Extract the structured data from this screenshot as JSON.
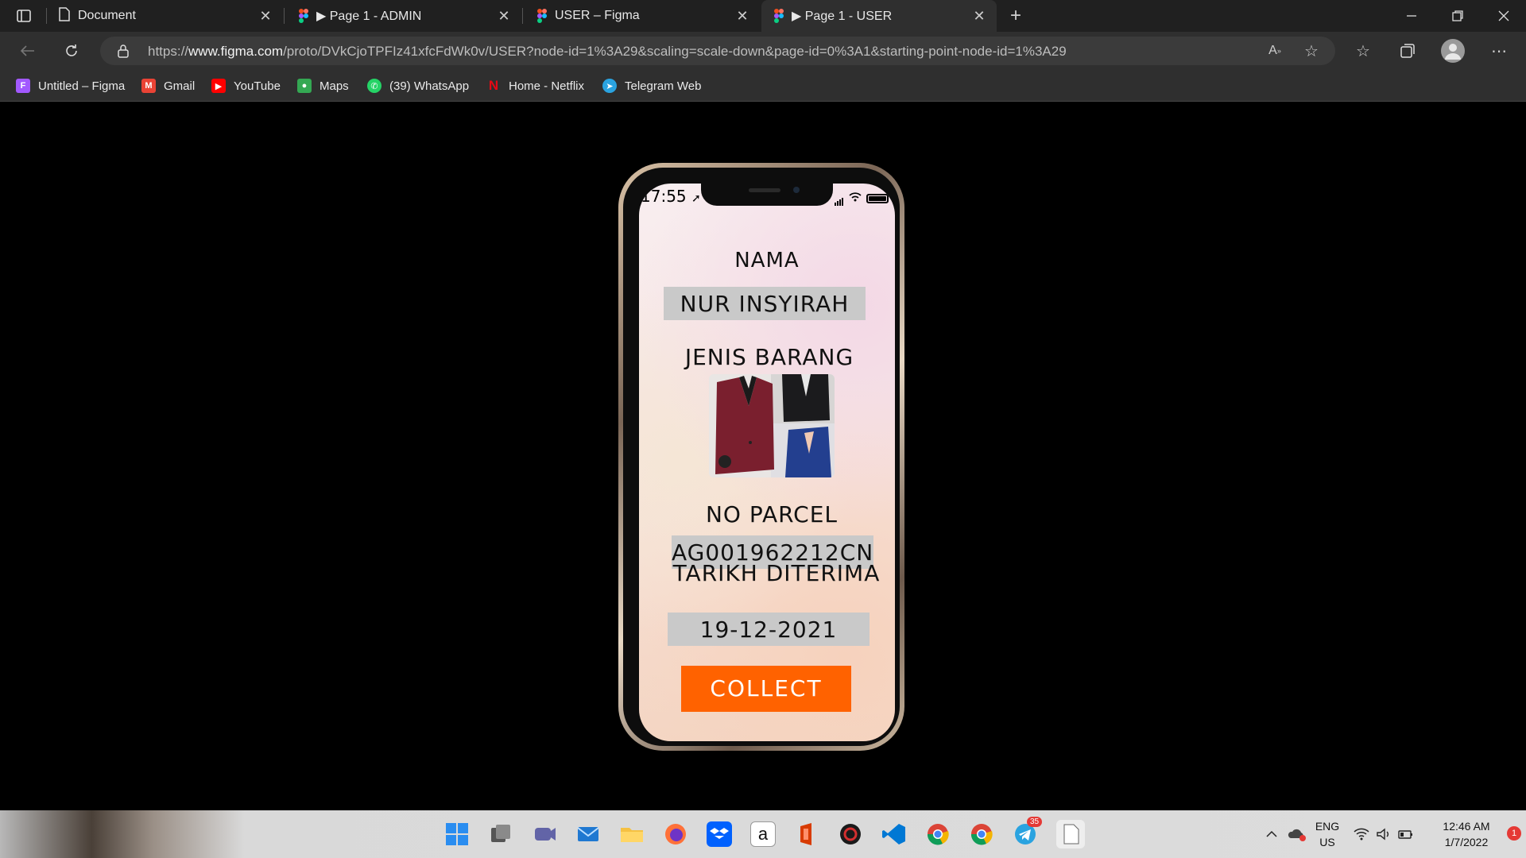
{
  "browser": {
    "tabs": [
      {
        "title": "Document"
      },
      {
        "title": "▶ Page 1 - ADMIN"
      },
      {
        "title": "USER – Figma"
      },
      {
        "title": "▶ Page 1 - USER"
      }
    ],
    "url_prefix": "https://",
    "url_host": "www.figma.com",
    "url_path": "/proto/DVkCjoTPFIz41xfcFdWk0v/USER?node-id=1%3A29&scaling=scale-down&page-id=0%3A1&starting-point-node-id=1%3A29",
    "bookmarks": [
      {
        "label": "Untitled – Figma",
        "icon": "figma-icon",
        "color": "#a259ff"
      },
      {
        "label": "Gmail",
        "icon": "gmail-icon",
        "color": "#ea4335"
      },
      {
        "label": "YouTube",
        "icon": "youtube-icon",
        "color": "#ff0000"
      },
      {
        "label": "Maps",
        "icon": "maps-icon",
        "color": "#34a853"
      },
      {
        "label": "(39) WhatsApp",
        "icon": "whatsapp-icon",
        "color": "#25d366"
      },
      {
        "label": "Home - Netflix",
        "icon": "netflix-icon",
        "color": "#e50914"
      },
      {
        "label": "Telegram Web",
        "icon": "telegram-icon",
        "color": "#2aa3e0"
      }
    ]
  },
  "phone": {
    "status_time": "17:55",
    "name_label": "NAMA",
    "name_value": "NUR INSYIRAH",
    "item_label": "JENIS BARANG",
    "parcel_label": "NO PARCEL",
    "parcel_value": "AG001962212CN",
    "date_label": "TARIKH DITERIMA",
    "date_value": "19-12-2021",
    "collect_label": "COLLECT"
  },
  "taskbar": {
    "lang_top": "ENG",
    "lang_bottom": "US",
    "time": "12:46 AM",
    "date": "1/7/2022",
    "telegram_badge": "35",
    "notification_count": "1"
  }
}
